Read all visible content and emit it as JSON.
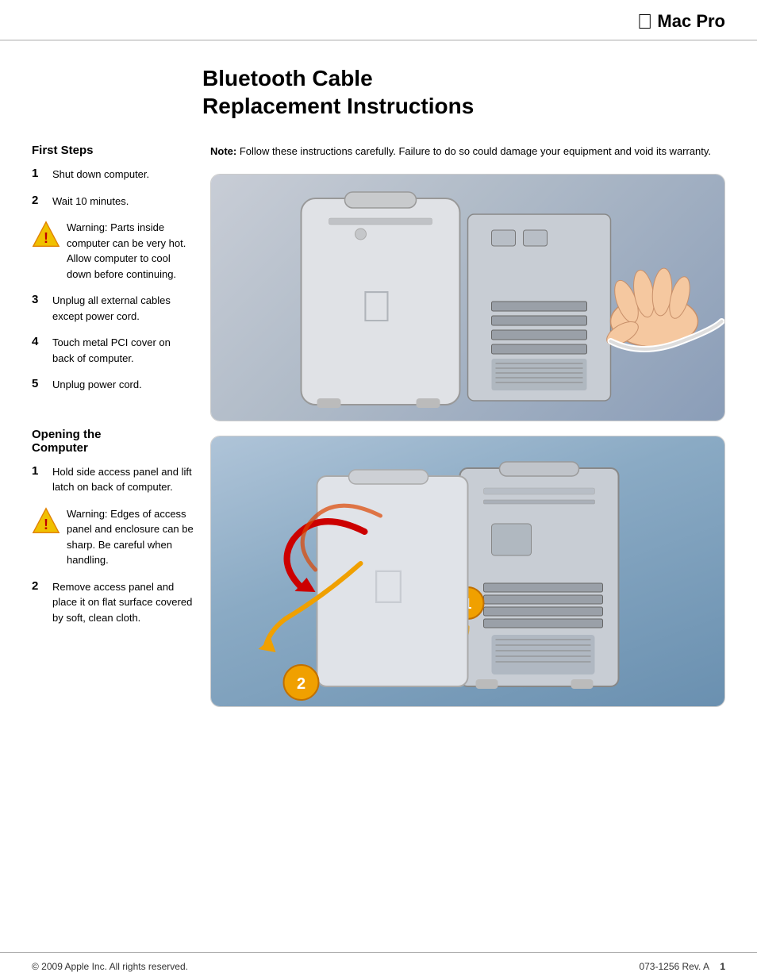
{
  "header": {
    "apple_logo": "",
    "title": "Mac Pro"
  },
  "page_title_line1": "Bluetooth Cable",
  "page_title_line2": "Replacement Instructions",
  "note": {
    "label": "Note:",
    "text": " Follow these instructions carefully. Failure to do so could damage your equipment and void its warranty."
  },
  "section1": {
    "heading": "First Steps",
    "steps": [
      {
        "number": "1",
        "text": "Shut down computer."
      },
      {
        "number": "2",
        "text": "Wait 10 minutes."
      },
      {
        "number": "3",
        "text": "Unplug all external cables except power cord."
      },
      {
        "number": "4",
        "text": "Touch metal PCI cover on back of computer."
      },
      {
        "number": "5",
        "text": "Unplug power cord."
      }
    ],
    "warning": {
      "bold": "Warning:",
      "text": " Parts inside computer can be very hot. Allow computer to cool down before continuing."
    }
  },
  "section2": {
    "heading": "Opening the\nComputer",
    "steps": [
      {
        "number": "1",
        "text": "Hold side access panel and lift latch on back of computer."
      },
      {
        "number": "2",
        "text": "Remove access panel and place it on flat surface covered by soft, clean cloth."
      }
    ],
    "warning": {
      "bold": "Warning:",
      "text": " Edges of access panel and enclosure can be sharp. Be careful when handling."
    }
  },
  "footer": {
    "copyright": "© 2009 Apple Inc. All rights reserved.",
    "doc_number": "073-1256 Rev. A",
    "page_number": "1"
  }
}
